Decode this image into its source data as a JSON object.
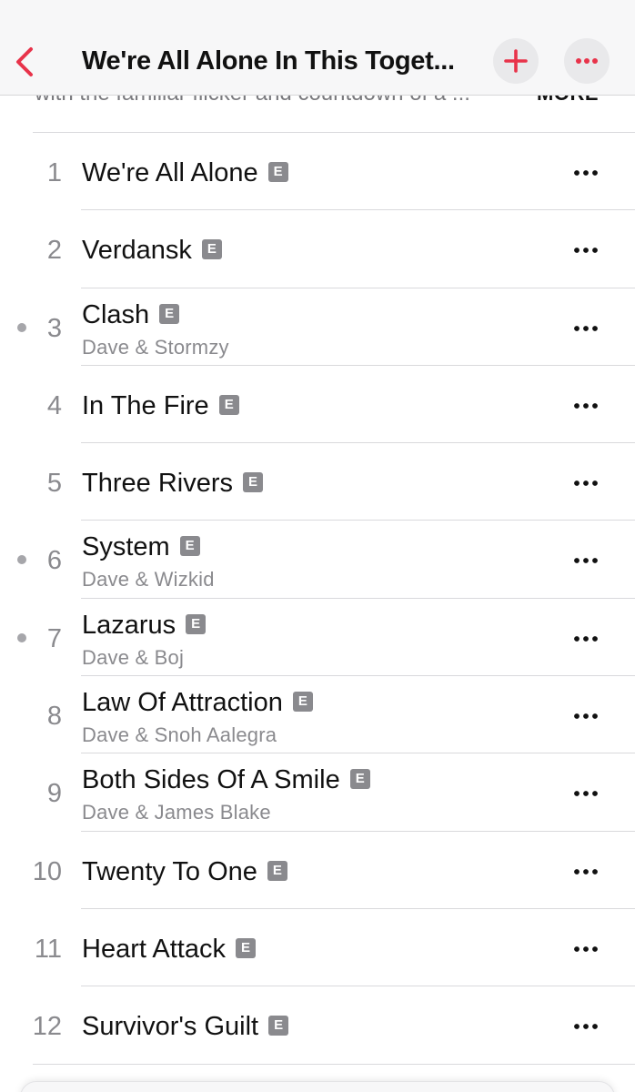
{
  "header": {
    "title": "We're All Alone In This Toget...",
    "back_icon": "chevron-left-icon",
    "add_icon": "plus-icon",
    "more_icon": "ellipsis-icon",
    "accent_color": "#e8334a"
  },
  "description": {
    "text": "with the familiar flicker and countdown of a ...",
    "more_label": "MORE"
  },
  "explicit_badge": "E",
  "tracks": [
    {
      "number": "1",
      "title": "We're All Alone",
      "artist": "",
      "dot": false
    },
    {
      "number": "2",
      "title": "Verdansk",
      "artist": "",
      "dot": false
    },
    {
      "number": "3",
      "title": "Clash",
      "artist": "Dave & Stormzy",
      "dot": true
    },
    {
      "number": "4",
      "title": "In The Fire",
      "artist": "",
      "dot": false
    },
    {
      "number": "5",
      "title": "Three Rivers",
      "artist": "",
      "dot": false
    },
    {
      "number": "6",
      "title": "System",
      "artist": "Dave & Wizkid",
      "dot": true
    },
    {
      "number": "7",
      "title": "Lazarus",
      "artist": "Dave & Boj",
      "dot": true
    },
    {
      "number": "8",
      "title": "Law Of Attraction",
      "artist": "Dave & Snoh Aalegra",
      "dot": false
    },
    {
      "number": "9",
      "title": "Both Sides Of A Smile",
      "artist": "Dave & James Blake",
      "dot": false
    },
    {
      "number": "10",
      "title": "Twenty To One",
      "artist": "",
      "dot": false
    },
    {
      "number": "11",
      "title": "Heart Attack",
      "artist": "",
      "dot": false
    },
    {
      "number": "12",
      "title": "Survivor's Guilt",
      "artist": "",
      "dot": false
    }
  ]
}
